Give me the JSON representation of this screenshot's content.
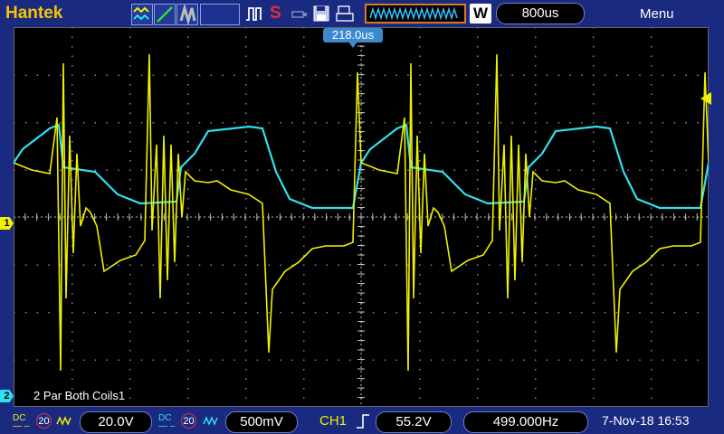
{
  "header": {
    "brand": "Hantek",
    "run_status_icon": "S",
    "timebase": "800us",
    "menu_label": "Menu",
    "acq_mode_icon": "W"
  },
  "screen": {
    "trigger_time": "218.0us",
    "ch1_marker": "1",
    "ch2_marker": "2",
    "label": "2 Par Both Coils1"
  },
  "bottom": {
    "ch1": {
      "coupling": "DC",
      "bw": "20",
      "scale": "20.0V"
    },
    "ch2": {
      "coupling": "DC",
      "bw": "20",
      "scale": "500mV"
    },
    "trigger": {
      "source": "CH1",
      "level": "55.2V"
    },
    "frequency": "499.000Hz",
    "datetime": "7-Nov-18 16:53"
  },
  "colors": {
    "ch1": "#f0f000",
    "ch2": "#30e0f0",
    "accent": "#f5c400"
  }
}
